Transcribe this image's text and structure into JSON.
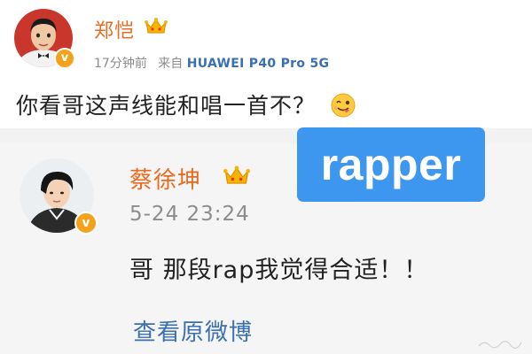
{
  "post": {
    "author": {
      "name": "郑恺",
      "verified": true,
      "badge_color": "#f4a21c"
    },
    "time": "17分钟前",
    "source_prefix": "来自",
    "source_device": "HUAWEI P40 Pro 5G",
    "text": "你看哥这声线能和唱一首不？",
    "emoji": "tongue-wink-emoji"
  },
  "repost": {
    "author": {
      "name": "蔡徐坤",
      "verified": true
    },
    "timestamp": "5-24 23:24",
    "text": "哥 那段rap我觉得合适！！",
    "view_original_label": "查看原微博"
  },
  "overlay": {
    "label": "rapper",
    "color": "#3e97ee"
  },
  "colors": {
    "username": "#e86b1f",
    "link": "#3a6fb0",
    "meta": "#8c8c8c",
    "repost_bg": "#f5f5f5"
  }
}
